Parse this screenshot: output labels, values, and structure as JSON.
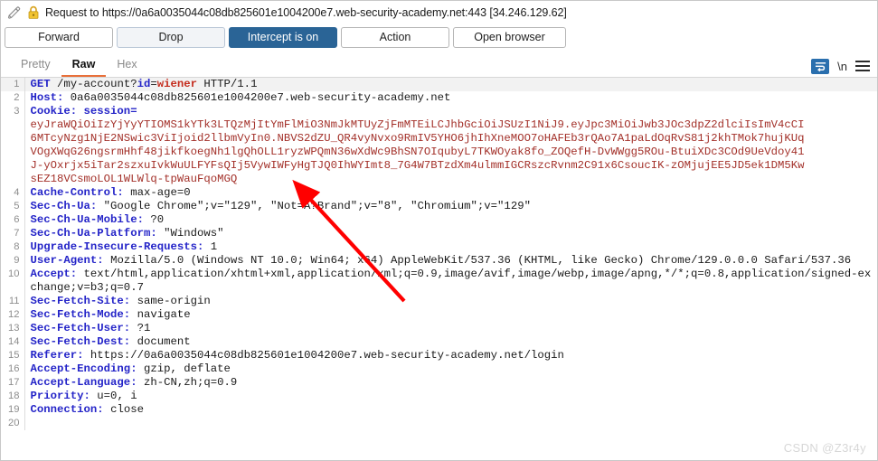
{
  "window": {
    "title": "Request to https://0a6a0035044c08db825601e1004200e7.web-security-academy.net:443  [34.246.129.62]",
    "pencil_icon": "pencil-icon",
    "lock_icon": "lock-icon"
  },
  "toolbar": {
    "forward_label": "Forward",
    "drop_label": "Drop",
    "intercept_label": "Intercept is on",
    "action_label": "Action",
    "open_browser_label": "Open browser"
  },
  "tabs": [
    {
      "label": "Pretty",
      "active": false
    },
    {
      "label": "Raw",
      "active": true
    },
    {
      "label": "Hex",
      "active": false
    }
  ],
  "tab_tools": {
    "wrap_icon": "word-wrap-icon",
    "newline_label": "\\n",
    "menu_icon": "hamburger-menu-icon"
  },
  "colors": {
    "accent_tab": "#e8703a",
    "primary_button": "#2a6496",
    "header_name": "#2424c8",
    "cookie_value": "#a33029",
    "param_value": "#c42b1c",
    "arrow": "#ff0000"
  },
  "request": {
    "line1_method": "GET ",
    "line1_path": "/my-account?",
    "line1_param_key": "id",
    "line1_eq": "=",
    "line1_param_val": "wiener",
    "line1_proto": " HTTP/1.1",
    "line2_name": "Host:",
    "line2_value": " 0a6a0035044c08db825601e1004200e7.web-security-academy.net",
    "line3_name": "Cookie:",
    "line3_value": " session=",
    "cookie_lines": [
      "eyJraWQiOiIzYjYyYTIOMS1kYTk3LTQzMjItYmFlMiO3NmJkMTUyZjFmMTEiLCJhbGciOiJSUzI1NiJ9.eyJpc3MiOiJwb3JOc3dpZ2dlciIsImV4cCI",
      "6MTcyNzg1NjE2NSwic3ViIjoid2llbmVyIn0.NBVS2dZU_QR4vyNvxo9RmIV5YHO6jhIhXneMOO7oHAFEb3rQAo7A1paLdOqRvS81j2khTMok7hujKUq",
      "VOgXWqG26ngsrmHhf48jikfkoegNh1lgQhOLL1ryzWPQmN36wXdWc9BhSN7OIqubyL7TKWOyak8fo_ZOQefH-DvWWgg5ROu-BtuiXDc3COd9UeVdoy41",
      "J-yOxrjx5iTar2szxuIvkWuULFYFsQIj5VywIWFyHgTJQ0IhWYImt8_7G4W7BTzdXm4ulmmIGCRszcRvnm2C91x6CsoucIK-zOMjujEE5JD5ek1DM5Kw",
      "sEZ18VCsmoLOL1WLWlq-tpWauFqoMGQ"
    ],
    "headers": [
      {
        "num": "4",
        "name": "Cache-Control:",
        "value": " max-age=0"
      },
      {
        "num": "5",
        "name": "Sec-Ch-Ua:",
        "value": " \"Google Chrome\";v=\"129\", \"Not=A?Brand\";v=\"8\", \"Chromium\";v=\"129\""
      },
      {
        "num": "6",
        "name": "Sec-Ch-Ua-Mobile:",
        "value": " ?0"
      },
      {
        "num": "7",
        "name": "Sec-Ch-Ua-Platform:",
        "value": " \"Windows\""
      },
      {
        "num": "8",
        "name": "Upgrade-Insecure-Requests:",
        "value": " 1"
      },
      {
        "num": "9",
        "name": "User-Agent:",
        "value": " Mozilla/5.0 (Windows NT 10.0; Win64; x64) AppleWebKit/537.36 (KHTML, like Gecko) Chrome/129.0.0.0 Safari/537.36"
      },
      {
        "num": "10",
        "name": "Accept:",
        "value": " text/html,application/xhtml+xml,application/xml;q=0.9,image/avif,image/webp,image/apng,*/*;q=0.8,application/signed-exchange;v=b3;q=0.7"
      },
      {
        "num": "11",
        "name": "Sec-Fetch-Site:",
        "value": " same-origin"
      },
      {
        "num": "12",
        "name": "Sec-Fetch-Mode:",
        "value": " navigate"
      },
      {
        "num": "13",
        "name": "Sec-Fetch-User:",
        "value": " ?1"
      },
      {
        "num": "14",
        "name": "Sec-Fetch-Dest:",
        "value": " document"
      },
      {
        "num": "15",
        "name": "Referer:",
        "value": " https://0a6a0035044c08db825601e1004200e7.web-security-academy.net/login"
      },
      {
        "num": "16",
        "name": "Accept-Encoding:",
        "value": " gzip, deflate"
      },
      {
        "num": "17",
        "name": "Accept-Language:",
        "value": " zh-CN,zh;q=0.9"
      },
      {
        "num": "18",
        "name": "Priority:",
        "value": " u=0, i"
      },
      {
        "num": "19",
        "name": "Connection:",
        "value": " close"
      },
      {
        "num": "20",
        "name": "",
        "value": ""
      }
    ]
  },
  "watermark": {
    "text": "CSDN @Z3r4y"
  }
}
